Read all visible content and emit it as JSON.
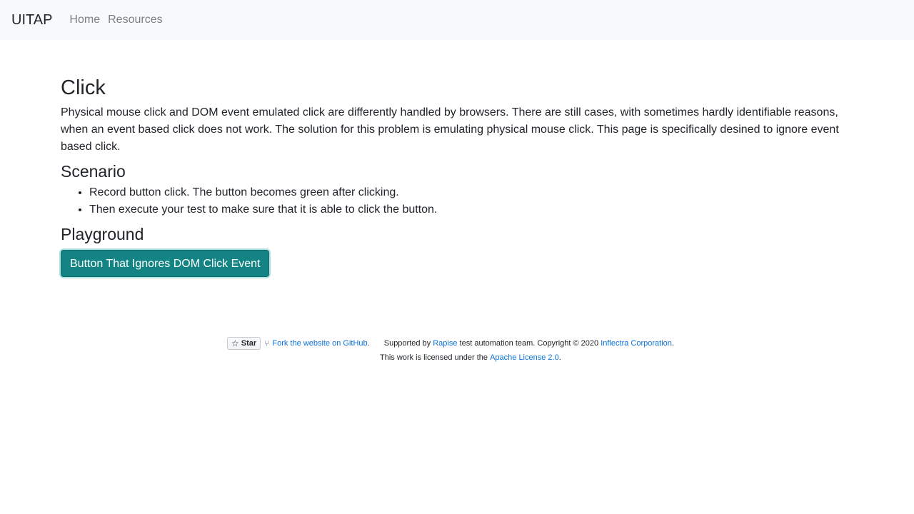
{
  "navbar": {
    "brand": "UITAP",
    "links": [
      "Home",
      "Resources"
    ]
  },
  "main": {
    "title": "Click",
    "description": "Physical mouse click and DOM event emulated click are differently handled by browsers. There are still cases, with sometimes hardly identifiable reasons, when an event based click does not work. The solution for this problem is emulating physical mouse click. This page is specifically desined to ignore event based click.",
    "scenario_heading": "Scenario",
    "scenario_items": [
      "Record button click. The button becomes green after clicking.",
      "Then execute your test to make sure that it is able to click the button."
    ],
    "playground_heading": "Playground",
    "button_label": "Button That Ignores DOM Click Event"
  },
  "footer": {
    "star_label": "Star",
    "fork_text": "Fork the website on GitHub",
    "fork_suffix": ".",
    "supported_prefix": "Supported by",
    "rapise_link": "Rapise",
    "supported_middle": "test automation team. Copyright © 2020",
    "inflectra_link": "Inflectra Corporation",
    "supported_suffix": ".",
    "license_prefix": "This work is licensed under the",
    "license_link": "Apache License 2.0",
    "license_suffix": ".",
    "colors": {
      "link": "#0b72d9",
      "button": "#138483",
      "navbar_bg": "#f8f9fa"
    }
  }
}
